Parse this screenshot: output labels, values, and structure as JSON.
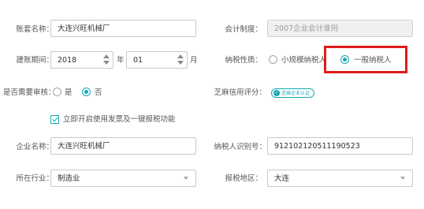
{
  "account": {
    "set_name_label": "账套名称：",
    "set_name_value": "大连兴旺机械厂",
    "accounting_system_label": "会计制度：",
    "accounting_system_value": "2007企业会计准则"
  },
  "period": {
    "label": "建账期间：",
    "year": "2018",
    "year_unit": "年",
    "month": "01",
    "month_unit": "月"
  },
  "taxpayer": {
    "label": "纳税性质：",
    "options": [
      "小规模纳税人",
      "一般纳税人"
    ],
    "selected": "一般纳税人"
  },
  "review": {
    "label": "是否需要审核：",
    "options": [
      "是",
      "否"
    ],
    "selected": "否"
  },
  "credit": {
    "label": "芝麻信用评分：",
    "badge": "芝麻企业认证"
  },
  "invoice_checkbox": {
    "label": "立即开启使用发票及一键报税功能",
    "checked": true
  },
  "company": {
    "name_label": "企业名称：",
    "name_value": "大连兴旺机械厂",
    "tax_id_label": "纳税人识别号：",
    "tax_id_value": "912102120511190523",
    "industry_label": "所在行业：",
    "industry_value": "制造业",
    "tax_region_label": "报税地区：",
    "tax_region_value": "大连"
  },
  "colors": {
    "accent": "#19a7b3",
    "highlight": "#e01b1b"
  }
}
